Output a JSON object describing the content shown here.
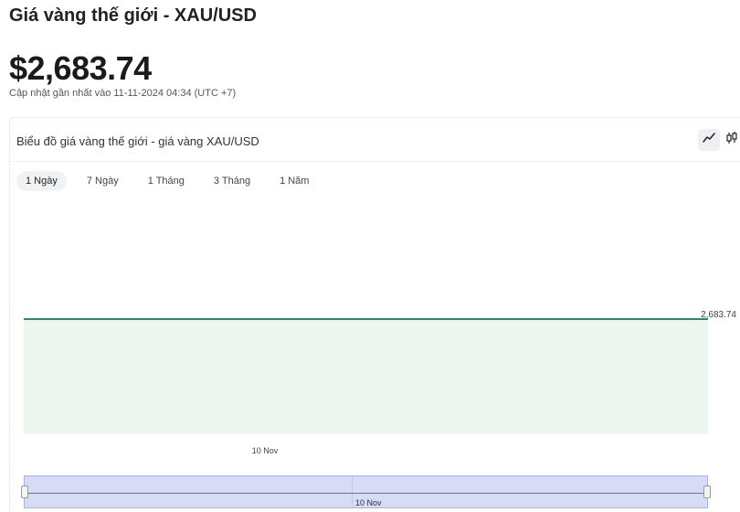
{
  "header": {
    "title": "Giá vàng thế giới - XAU/USD",
    "price": "$2,683.74",
    "updated": "Cập nhật gần nhất vào 11-11-2024 04:34 (UTC +7)"
  },
  "card": {
    "title": "Biểu đồ giá vàng thế giới - giá vàng XAU/USD",
    "chart_type_icons": [
      "line-chart-icon",
      "candlestick-chart-icon"
    ],
    "ranges": [
      "1 Ngày",
      "7 Ngày",
      "1 Tháng",
      "3 Tháng",
      "1 Năm"
    ],
    "active_range": "1 Ngày"
  },
  "navigator": {
    "label": "10 Nov"
  },
  "colors": {
    "line": "#2e8b57",
    "area": "#eef7ef",
    "navigator_fill": "#d6dcf6"
  },
  "chart_data": {
    "type": "area",
    "x": [
      "10 Nov"
    ],
    "series": [
      {
        "values": [
          2683.74,
          2683.74
        ]
      }
    ],
    "last_value_label": "2,683.74",
    "xlabel": "",
    "ylabel": "",
    "grid": false
  }
}
